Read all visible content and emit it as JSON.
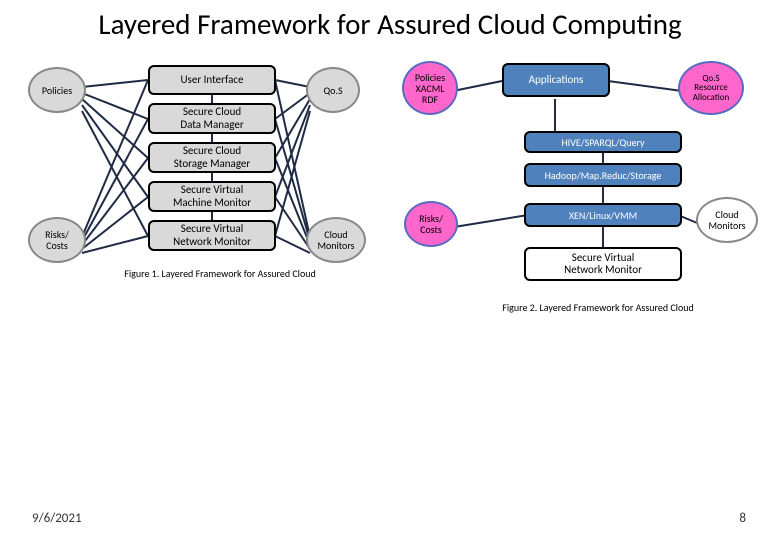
{
  "title": "Layered Framework for Assured Cloud Computing",
  "fig1": {
    "policies": "Policies",
    "risks": "Risks/\nCosts",
    "qos": "Qo.S",
    "monitors": "Cloud\nMonitors",
    "stack": [
      "User Interface",
      "Secure Cloud\nData Manager",
      "Secure Cloud\nStorage Manager",
      "Secure Virtual\nMachine Monitor",
      "Secure Virtual\nNetwork Monitor"
    ],
    "caption": "Figure 1.  Layered Framework for Assured Cloud"
  },
  "fig2": {
    "policies": "Policies\nXACML\nRDF",
    "qos": "Qo.S\nResource\nAllocation",
    "risks": "Risks/\nCosts",
    "monitors": "Cloud\nMonitors",
    "applications": "Applications",
    "stack": [
      "HIVE/SPARQL/Query",
      "Hadoop/Map.Reduc/Storage",
      "XEN/Linux/VMM",
      "Secure Virtual\nNetwork Monitor"
    ],
    "caption": "Figure 2.  Layered Framework for Assured Cloud"
  },
  "footer": {
    "date": "9/6/2021",
    "page": "8"
  }
}
